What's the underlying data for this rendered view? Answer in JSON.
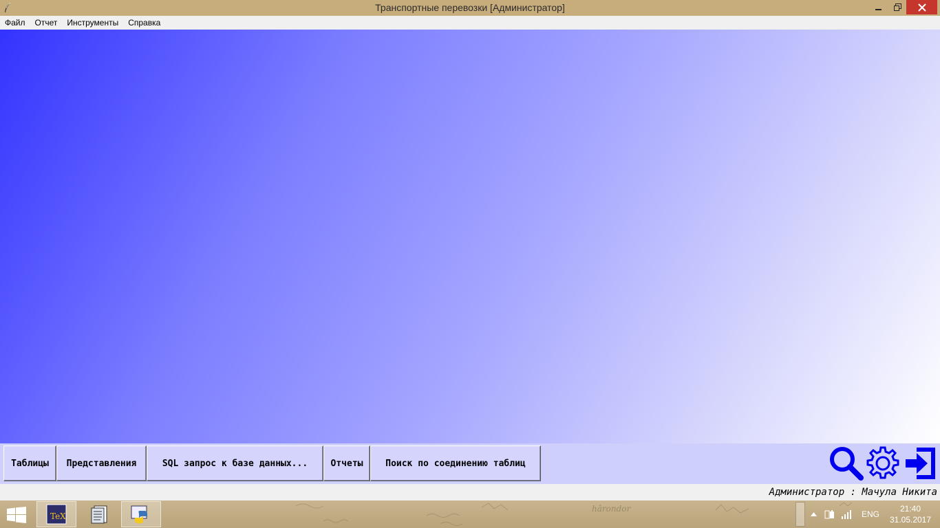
{
  "window": {
    "title": "Транспортные перевозки [Администратор]",
    "title_icon": "feather-icon",
    "controls": [
      "minimize-icon",
      "restore-icon",
      "close-icon"
    ]
  },
  "menu": {
    "items": [
      "Файл",
      "Отчет",
      "Инструменты",
      "Справка"
    ]
  },
  "toolbar": {
    "buttons": [
      "Таблицы",
      "Представления",
      "SQL запрос к базе данных...",
      "Отчеты",
      "Поиск по соединению таблиц"
    ],
    "icons": [
      "search-icon",
      "settings-gear-icon",
      "exit-icon"
    ],
    "icon_color": "#0000ee"
  },
  "status": {
    "text": "Администратор : Мачула Никита"
  },
  "taskbar": {
    "apps": [
      "texmaker-icon",
      "file-manager-icon",
      "python-icon"
    ],
    "language": "ENG",
    "time": "21:40",
    "date": "31.05.2017"
  },
  "colors": {
    "gradient_start": "#3333ff",
    "gradient_end": "#ffffff",
    "toolbar_bg": "#cfcffc",
    "close_button": "#c7362c"
  }
}
